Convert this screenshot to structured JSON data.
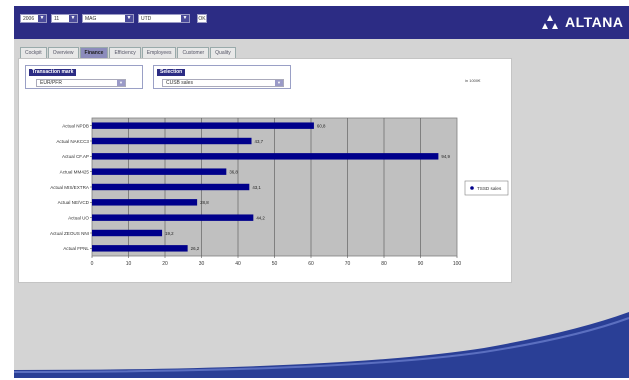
{
  "topbar": {
    "selects": [
      {
        "value": "2006"
      },
      {
        "value": "11"
      },
      {
        "value": "MAG"
      },
      {
        "value": "UTD"
      }
    ],
    "ok_label": "OK",
    "brand": "ALTANA"
  },
  "tabs": [
    {
      "label": "Cockpit",
      "active": false
    },
    {
      "label": "Overview",
      "active": false
    },
    {
      "label": "Finance",
      "active": true
    },
    {
      "label": "Efficiency",
      "active": false
    },
    {
      "label": "Employees",
      "active": false
    },
    {
      "label": "Customer",
      "active": false
    },
    {
      "label": "Quality",
      "active": false
    }
  ],
  "filters": {
    "first": {
      "label": "Transaction mark",
      "value": "EUR/PFR"
    },
    "second": {
      "label": "Selection",
      "value": "CUSB sales"
    }
  },
  "corner_text": "in 1000€",
  "legend": {
    "label": "TSSD sales"
  },
  "colors": {
    "bar": "#00008b",
    "plot_bg": "#c0c0c0",
    "topbar": "#2c2c84"
  },
  "chart_data": {
    "type": "bar",
    "orientation": "horizontal",
    "categories": [
      "Actual NPDB",
      "Actual NAKCC3",
      "Actual CF.AP",
      "Actual MM425",
      "Actual MIS/EXTRA",
      "Actual NE/VCD",
      "Actual UO",
      "Actual ZEOUS NNI",
      "Actual FPNL"
    ],
    "series": [
      {
        "name": "TSSD sales",
        "values": [
          60.8,
          43.7,
          94.9,
          36.8,
          43.1,
          28.8,
          44.2,
          19.2,
          26.2
        ]
      }
    ],
    "value_labels": [
      "60,8",
      "43,7",
      "94,9",
      "36,8",
      "43,1",
      "28,8",
      "44,2",
      "19,2",
      "26,2"
    ],
    "xlim": [
      0,
      100
    ],
    "xticks": [
      0,
      10,
      20,
      30,
      40,
      50,
      60,
      70,
      80,
      90,
      100
    ],
    "grid": true,
    "legend_position": "right"
  }
}
